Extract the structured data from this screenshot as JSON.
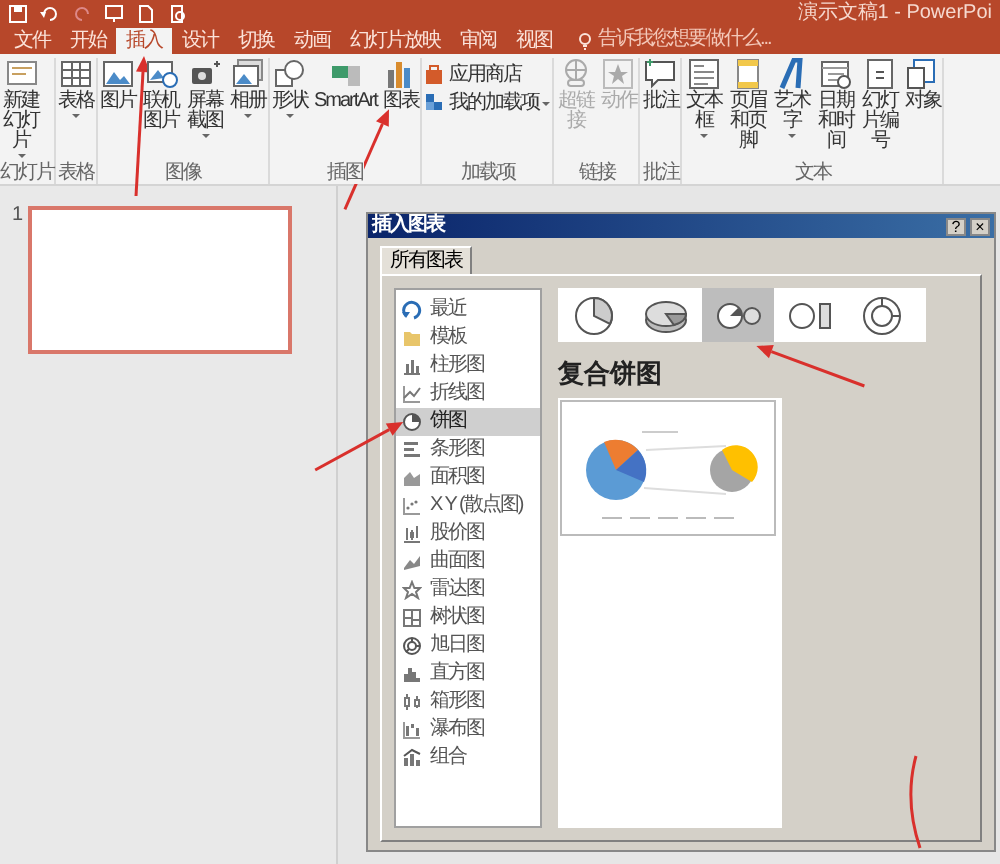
{
  "title_bar": {
    "document_title": "演示文稿1 - PowerPoi"
  },
  "ribbon_tabs": [
    {
      "label": "文件",
      "selected": false
    },
    {
      "label": "开始",
      "selected": false
    },
    {
      "label": "插入",
      "selected": true
    },
    {
      "label": "设计",
      "selected": false
    },
    {
      "label": "切换",
      "selected": false
    },
    {
      "label": "动画",
      "selected": false
    },
    {
      "label": "幻灯片放映",
      "selected": false
    },
    {
      "label": "审阅",
      "selected": false
    },
    {
      "label": "视图",
      "selected": false
    }
  ],
  "tell_me": {
    "placeholder": "告诉我您想要做什么..."
  },
  "ribbon_groups": [
    {
      "label": "幻灯片",
      "kind": "large",
      "buttons": [
        {
          "label": "新建幻灯片",
          "kind": "newslide",
          "dropdown": true,
          "disabled": false
        }
      ]
    },
    {
      "label": "表格",
      "kind": "large",
      "buttons": [
        {
          "label": "表格",
          "kind": "table",
          "dropdown": true,
          "disabled": false
        }
      ]
    },
    {
      "label": "图像",
      "kind": "large",
      "buttons": [
        {
          "label": "图片",
          "kind": "picture",
          "dropdown": false,
          "disabled": false
        },
        {
          "label": "联机图片",
          "kind": "onlinepicture",
          "dropdown": false,
          "disabled": false
        },
        {
          "label": "屏幕截图",
          "kind": "screenshot",
          "dropdown": true,
          "disabled": false
        },
        {
          "label": "相册",
          "kind": "album",
          "dropdown": true,
          "disabled": false
        }
      ]
    },
    {
      "label": "插图",
      "kind": "large",
      "buttons": [
        {
          "label": "形状",
          "kind": "shapes",
          "dropdown": true,
          "disabled": false
        },
        {
          "label": "SmartArt",
          "kind": "smartart",
          "dropdown": false,
          "disabled": false
        },
        {
          "label": "图表",
          "kind": "chart",
          "dropdown": false,
          "disabled": false
        }
      ]
    },
    {
      "label": "加载项",
      "kind": "small",
      "buttons": [
        {
          "label": "应用商店",
          "kind": "store",
          "dropdown": false,
          "disabled": false
        },
        {
          "label": "我的加载项",
          "kind": "addins",
          "dropdown": true,
          "disabled": false
        }
      ]
    },
    {
      "label": "链接",
      "kind": "large",
      "buttons": [
        {
          "label": "超链接",
          "kind": "hyperlink",
          "dropdown": false,
          "disabled": true
        },
        {
          "label": "动作",
          "kind": "action",
          "dropdown": false,
          "disabled": true
        }
      ]
    },
    {
      "label": "批注",
      "kind": "large",
      "buttons": [
        {
          "label": "批注",
          "kind": "comment",
          "dropdown": false,
          "disabled": false
        }
      ]
    },
    {
      "label": "文本",
      "kind": "large",
      "buttons": [
        {
          "label": "文本框",
          "kind": "textbox",
          "dropdown": true,
          "disabled": false
        },
        {
          "label": "页眉和页脚",
          "kind": "headerfooter",
          "dropdown": false,
          "disabled": false
        },
        {
          "label": "艺术字",
          "kind": "wordart",
          "dropdown": true,
          "disabled": false
        },
        {
          "label": "日期和时间",
          "kind": "datetime",
          "dropdown": false,
          "disabled": false
        },
        {
          "label": "幻灯片编号",
          "kind": "slidenumber",
          "dropdown": false,
          "disabled": false
        },
        {
          "label": "对象",
          "kind": "object",
          "dropdown": false,
          "disabled": false
        }
      ]
    }
  ],
  "slides": [
    {
      "number": "1",
      "selected": true
    }
  ],
  "dialog": {
    "title": "插入图表",
    "help_button": "?",
    "close_button": "×",
    "tabs": [
      {
        "label": "所有图表",
        "selected": true
      }
    ],
    "categories": [
      {
        "label": "最近",
        "kind": "recent",
        "selected": false
      },
      {
        "label": "模板",
        "kind": "template",
        "selected": false
      },
      {
        "label": "柱形图",
        "kind": "column",
        "selected": false
      },
      {
        "label": "折线图",
        "kind": "line",
        "selected": false
      },
      {
        "label": "饼图",
        "kind": "pie",
        "selected": true
      },
      {
        "label": "条形图",
        "kind": "bar",
        "selected": false
      },
      {
        "label": "面积图",
        "kind": "area",
        "selected": false
      },
      {
        "label": "X Y (散点图)",
        "kind": "scatter",
        "selected": false
      },
      {
        "label": "股价图",
        "kind": "stock",
        "selected": false
      },
      {
        "label": "曲面图",
        "kind": "surface",
        "selected": false
      },
      {
        "label": "雷达图",
        "kind": "radar",
        "selected": false
      },
      {
        "label": "树状图",
        "kind": "treemap",
        "selected": false
      },
      {
        "label": "旭日图",
        "kind": "sunburst",
        "selected": false
      },
      {
        "label": "直方图",
        "kind": "histogram",
        "selected": false
      },
      {
        "label": "箱形图",
        "kind": "box",
        "selected": false
      },
      {
        "label": "瀑布图",
        "kind": "waterfall",
        "selected": false
      },
      {
        "label": "组合",
        "kind": "combo",
        "selected": false
      }
    ],
    "subtypes": [
      {
        "kind": "pie",
        "selected": false
      },
      {
        "kind": "pie3d",
        "selected": false
      },
      {
        "kind": "pieofpie",
        "selected": true
      },
      {
        "kind": "barofpie",
        "selected": false
      },
      {
        "kind": "doughnut",
        "selected": false
      }
    ],
    "subtype_title": "复合饼图"
  }
}
